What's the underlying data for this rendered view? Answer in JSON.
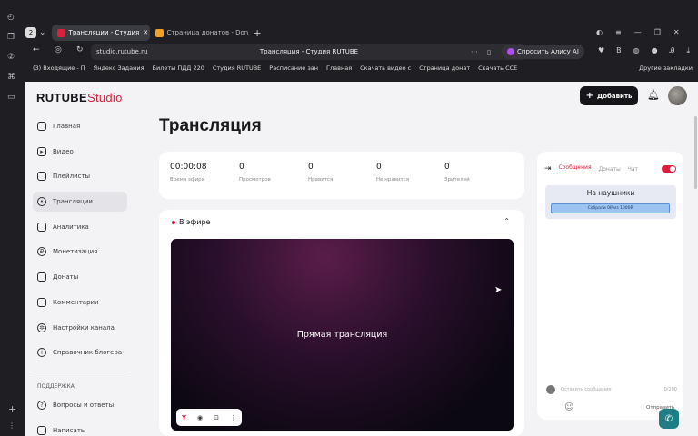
{
  "browser": {
    "tab_count": "2",
    "tabs": [
      {
        "title": "Трансляции - Студия",
        "active": true
      },
      {
        "title": "Страница донатов - Don",
        "active": false
      }
    ],
    "url": "studio.rutube.ru",
    "page_title": "Трансляция - Студия RUTUBE",
    "alice_button": "Спросить Алису AI",
    "bookmarks": [
      "(3) Входящие - П",
      "Яндекс Задания",
      "Билеты ПДД 220",
      "Студия RUTUBE",
      "Расписание зан",
      "Главная",
      "Скачать видео с",
      "Страница донат",
      "Скачать ССЕ"
    ],
    "bookmarks_other": "Другие закладки"
  },
  "app": {
    "logo_main": "RUTUBE",
    "logo_sub": "Studio",
    "add_button": "Добавить",
    "page_title": "Трансляция"
  },
  "sidebar": {
    "items": [
      {
        "label": "Главная",
        "icon": "home-icon",
        "active": false
      },
      {
        "label": "Видео",
        "icon": "video-icon",
        "active": false
      },
      {
        "label": "Плейлисты",
        "icon": "playlist-icon",
        "active": false
      },
      {
        "label": "Трансляции",
        "icon": "broadcast-icon",
        "active": true
      },
      {
        "label": "Аналитика",
        "icon": "analytics-icon",
        "active": false
      },
      {
        "label": "Монетизация",
        "icon": "money-icon",
        "active": false
      },
      {
        "label": "Донаты",
        "icon": "donate-icon",
        "active": false
      },
      {
        "label": "Комментарии",
        "icon": "comments-icon",
        "active": false
      },
      {
        "label": "Настройки канала",
        "icon": "settings-icon",
        "active": false
      },
      {
        "label": "Справочник блогера",
        "icon": "info-icon",
        "active": false
      }
    ],
    "support_header": "ПОДДЕРЖКА",
    "support_items": [
      {
        "label": "Вопросы и ответы",
        "icon": "help-icon"
      },
      {
        "label": "Написать",
        "icon": "write-icon"
      }
    ]
  },
  "stats": [
    {
      "value": "00:00:08",
      "label": "Время эфира"
    },
    {
      "value": "0",
      "label": "Просмотров"
    },
    {
      "value": "0",
      "label": "Нравится"
    },
    {
      "value": "0",
      "label": "Не нравится"
    },
    {
      "value": "0",
      "label": "Зрителей"
    }
  ],
  "live": {
    "status": "В эфире",
    "player_text": "Прямая трансляция"
  },
  "chat": {
    "tabs": [
      "Сообщения",
      "Донаты",
      "Чат"
    ],
    "pinned_title": "На наушники",
    "pinned_badge": "Собрали 0₽ из 1000₽",
    "input_placeholder": "Оставить сообщение",
    "char_count": "0/200",
    "send_label": "Отправить"
  }
}
